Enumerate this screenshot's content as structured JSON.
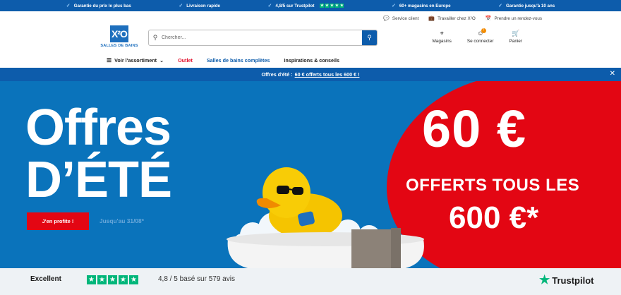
{
  "topbar": {
    "benefits": [
      "Garantie du prix le plus bas",
      "Livraison rapide",
      "4,8/5 sur Trustpilot",
      "60+ magasins en Europe",
      "Garantie jusqu'à 10 ans"
    ]
  },
  "utility": {
    "service": "Service client",
    "jobs": "Travailler chez X²O",
    "appointment": "Prendre un rendez-vous"
  },
  "header": {
    "logo_mark": "X²O",
    "logo_text": "SALLES DE BAINS",
    "search_placeholder": "Chercher...",
    "stores": "Magasins",
    "login": "Se connecter",
    "cart": "Panier"
  },
  "nav": {
    "assortment": "Voir l'assortiment",
    "outlet": "Outlet",
    "complete": "Salles de bains complètes",
    "inspiration": "Inspirations & conseils"
  },
  "promo": {
    "text": "Offres d'été :",
    "link": "60 € offerts tous les 600 € !"
  },
  "hero": {
    "title_line1": "Offres",
    "title_line2": "D’ÉTÉ",
    "cta": "J'en profite !",
    "until": "Jusqu'au 31/08*",
    "amount": "60 €",
    "offer_text": "OFFERTS TOUS LES",
    "threshold": "600 €*"
  },
  "trust": {
    "label": "Excellent",
    "score": "4,8 / 5 basé sur 579 avis",
    "brand": "Trustpilot"
  },
  "colors": {
    "brand_blue": "#0d5cab",
    "hero_blue": "#0a73bb",
    "accent_red": "#e30613",
    "trustpilot_green": "#00b67a"
  }
}
